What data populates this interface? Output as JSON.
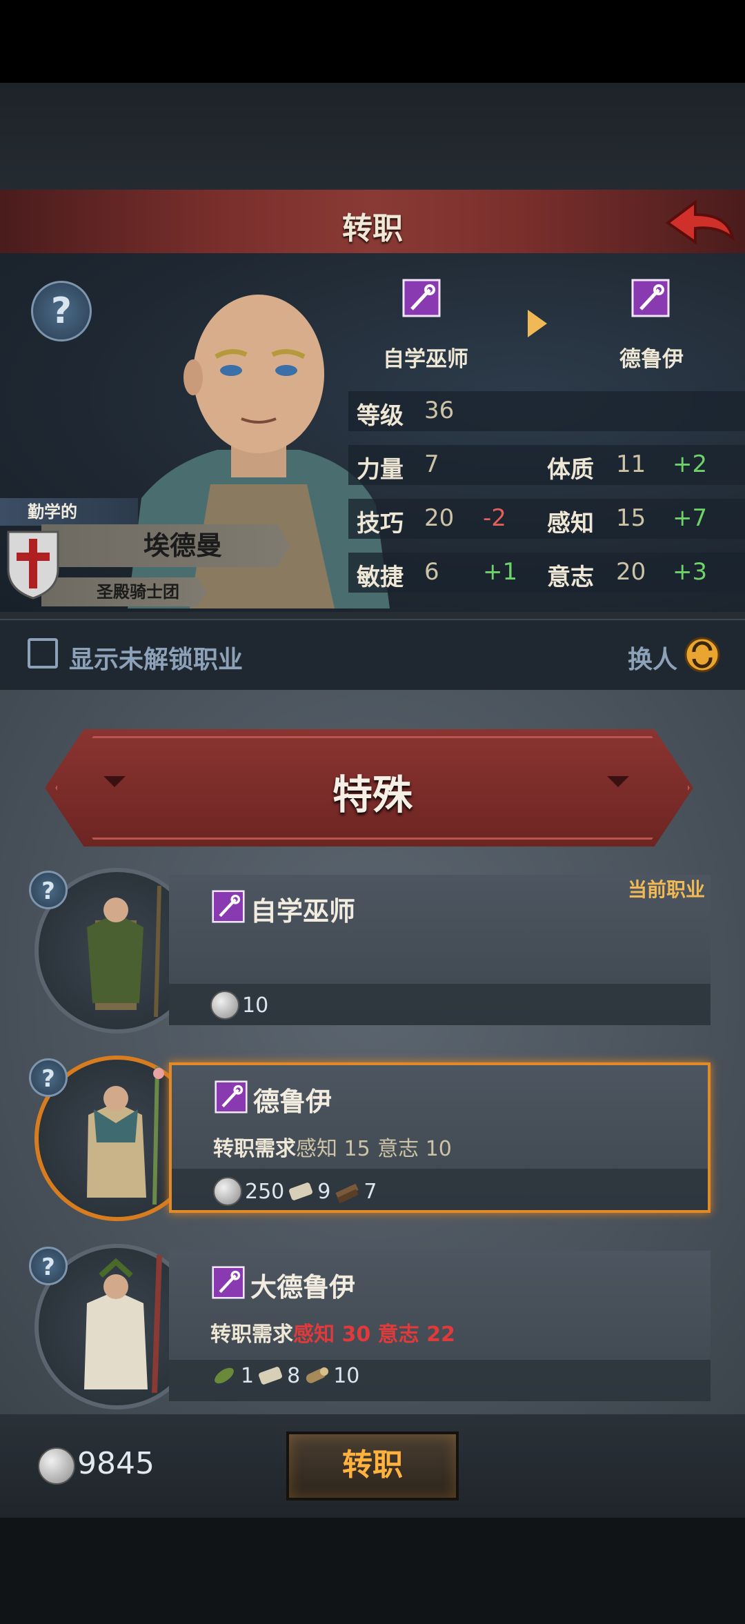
{
  "header": {
    "title": "转职"
  },
  "character": {
    "trait": "勤学的",
    "name": "埃德曼",
    "guild": "圣殿骑士团",
    "from_class": "自学巫师",
    "to_class": "德鲁伊",
    "level_label": "等级",
    "level": "36",
    "stats": {
      "str": {
        "label": "力量",
        "value": "7",
        "delta": ""
      },
      "con": {
        "label": "体质",
        "value": "11",
        "delta": "+2"
      },
      "skl": {
        "label": "技巧",
        "value": "20",
        "delta": "-2"
      },
      "per": {
        "label": "感知",
        "value": "15",
        "delta": "+7"
      },
      "agi": {
        "label": "敏捷",
        "value": "6",
        "delta": "+1"
      },
      "wil": {
        "label": "意志",
        "value": "20",
        "delta": "+3"
      }
    }
  },
  "filter": {
    "show_locked_label": "显示未解锁职业",
    "swap_label": "换人"
  },
  "category": {
    "title": "特殊"
  },
  "cards": [
    {
      "title": "自学巫师",
      "tag": "当前职业",
      "req_prefix": "",
      "req_a": "",
      "req_b": "",
      "coin": "10",
      "res1": "",
      "res2": ""
    },
    {
      "title": "德鲁伊",
      "tag": "",
      "req_prefix": "转职需求",
      "req_a": "感知 15",
      "req_b": "意志 10",
      "coin": "250",
      "res1": "9",
      "res2": "7"
    },
    {
      "title": "大德鲁伊",
      "tag": "",
      "req_prefix": "转职需求",
      "req_a": "感知 30",
      "req_b": "意志 22",
      "res_leaf": "1",
      "res1": "8",
      "res_log": "10"
    }
  ],
  "footer": {
    "money": "9845",
    "confirm_label": "转职"
  },
  "colors": {
    "accent": "#f0b955",
    "selected": "#e08a2a",
    "danger": "#e03a3a",
    "bonus": "#6fd36a"
  }
}
